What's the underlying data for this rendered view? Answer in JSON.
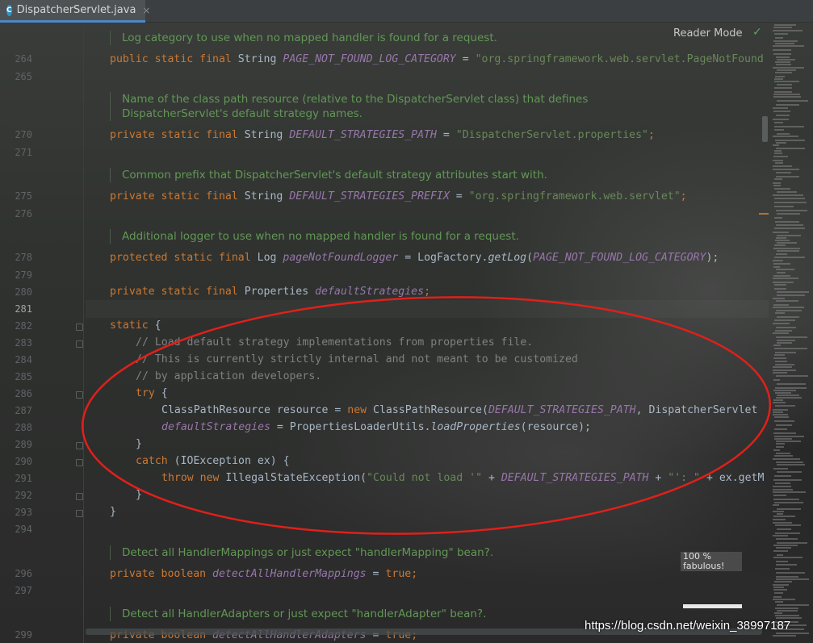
{
  "window": {
    "tab_title": "DispatcherServlet.java",
    "tab_icon": "C",
    "close_glyph": "×"
  },
  "reader_mode": "Reader Mode",
  "zoom": {
    "percent": "100 %",
    "label": "fabulous!"
  },
  "watermark": "https://blog.csdn.net/weixin_38997187",
  "line_numbers": [
    "264",
    "265",
    "270",
    "271",
    "275",
    "276",
    "278",
    "279",
    "280",
    "281",
    "282",
    "283",
    "284",
    "285",
    "286",
    "287",
    "288",
    "289",
    "290",
    "291",
    "292",
    "293",
    "294",
    "296",
    "297",
    "299"
  ],
  "docs": {
    "d1": "Log category to use when no mapped handler is found for a request.",
    "d2a": "Name of the class path resource (relative to the DispatcherServlet class) that defines",
    "d2b": "DispatcherServlet's default strategy names.",
    "d3": "Common prefix that DispatcherServlet's default strategy attributes start with.",
    "d4": "Additional logger to use when no mapped handler is found for a request.",
    "d5": "Detect all HandlerMappings or just expect \"handlerMapping\" bean?.",
    "d6": "Detect all HandlerAdapters or just expect \"handlerAdapter\" bean?."
  },
  "code": {
    "l264": {
      "kw": "public static final ",
      "type": "String ",
      "name": "PAGE_NOT_FOUND_LOG_CATEGORY",
      "eq": " = ",
      "str": "\"org.springframework.web.servlet.PageNotFound"
    },
    "l270": {
      "kw": "private static final ",
      "type": "String ",
      "name": "DEFAULT_STRATEGIES_PATH",
      "eq": " = ",
      "str": "\"DispatcherServlet.properties\"",
      "end": ";"
    },
    "l275": {
      "kw": "private static final ",
      "type": "String ",
      "name": "DEFAULT_STRATEGIES_PREFIX",
      "eq": " = ",
      "str": "\"org.springframework.web.servlet\"",
      "end": ";"
    },
    "l278": {
      "kw": "protected static final ",
      "type": "Log ",
      "name": "pageNotFoundLogger",
      "eq": " = LogFactory.",
      "call": "getLog",
      "open": "(",
      "arg": "PAGE_NOT_FOUND_LOG_CATEGORY",
      "end": ");"
    },
    "l280": {
      "kw": "private static final ",
      "type": "Properties ",
      "name": "defaultStrategies",
      "end": ";"
    },
    "l282": {
      "kw": "static",
      "rest": " {"
    },
    "l283": "// Load default strategy implementations from properties file.",
    "l284": "// This is currently strictly internal and not meant to be customized",
    "l285": "// by application developers.",
    "l286": {
      "kw": "try",
      "rest": " {"
    },
    "l287": {
      "a": "ClassPathResource resource = ",
      "kw": "new",
      "b": " ClassPathResource(",
      "c": "DEFAULT_STRATEGIES_PATH",
      "d": ", DispatcherServlet"
    },
    "l288": {
      "fi": "defaultStrategies",
      "a": " = PropertiesLoaderUtils.",
      "mi": "loadProperties",
      "b": "(resource);"
    },
    "l289": "}",
    "l290": {
      "kw": "catch",
      "rest": " (IOException ex) {"
    },
    "l291": {
      "kw": "throw new",
      "a": " IllegalStateException(",
      "st1": "\"Could not load '\"",
      "b": " + ",
      "c": "DEFAULT_STRATEGIES_PATH",
      "d": " + ",
      "st2": "\"': \"",
      "e": " + ex.getM"
    },
    "l292": "}",
    "l293": "}",
    "l296": {
      "kw": "private boolean ",
      "name": "detectAllHandlerMappings",
      "eq": " = ",
      "val": "true",
      "end": ";"
    },
    "l299": {
      "kw": "private boolean ",
      "name": "detectAllHandlerAdapters",
      "eq": " = ",
      "val": "true",
      "end": ";"
    }
  },
  "colors": {
    "keyword": "#cc7832",
    "constant": "#9876aa",
    "string": "#6a8759",
    "comment": "#808080",
    "doc": "#629755",
    "annotation_circle": "#e0201a"
  }
}
